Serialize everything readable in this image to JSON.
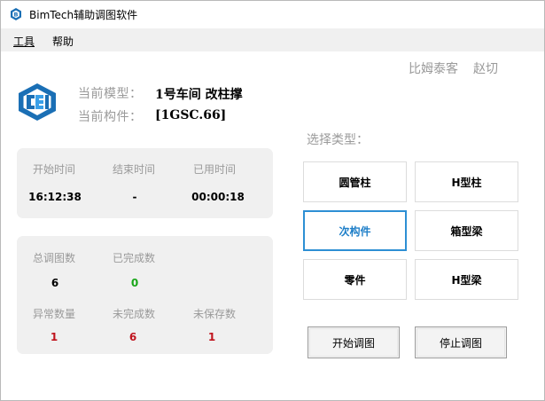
{
  "window": {
    "title": "BimTech辅助调图软件"
  },
  "menu": [
    {
      "label": "工具",
      "accel": "工"
    },
    {
      "label": "帮助"
    }
  ],
  "credits": {
    "name1": "比姆泰客",
    "name2": "赵切"
  },
  "model": {
    "model_label": "当前模型：",
    "model_value": "1号车间 改柱撑",
    "component_label": "当前构件：",
    "component_value": "[1GSC.66]"
  },
  "timing": {
    "start_label": "开始时间",
    "end_label": "结束时间",
    "elapsed_label": "已用时间",
    "start_value": "16:12:38",
    "end_value": "-",
    "elapsed_value": "00:00:18"
  },
  "stats": {
    "total_label": "总调图数",
    "completed_label": "已完成数",
    "total_value": "6",
    "completed_value": "0",
    "abnormal_label": "异常数量",
    "incomplete_label": "未完成数",
    "unsaved_label": "未保存数",
    "abnormal_value": "1",
    "incomplete_value": "6",
    "unsaved_value": "1"
  },
  "type_select": {
    "label": "选择类型：",
    "options": [
      "圆管柱",
      "H型柱",
      "次构件",
      "箱型梁",
      "零件",
      "H型梁"
    ],
    "selected": "次构件"
  },
  "actions": {
    "start": "开始调图",
    "stop": "停止调图"
  },
  "colors": {
    "accent_blue": "#2d8fd4",
    "logo_blue": "#1a6fb5",
    "completed_green": "#19a619",
    "alert_red": "#c0141e",
    "label_gray": "#9a9a9a",
    "panel_gray": "#f0f0f0"
  }
}
